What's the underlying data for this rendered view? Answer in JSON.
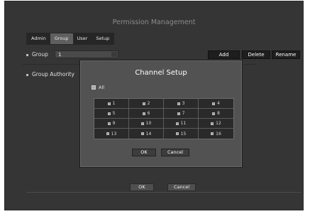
{
  "window": {
    "title": "Permission Management"
  },
  "tabs": [
    {
      "label": "Admin"
    },
    {
      "label": "Group"
    },
    {
      "label": "User"
    },
    {
      "label": "Setup"
    }
  ],
  "group_row": {
    "label": "Group",
    "value": "1"
  },
  "group_buttons": {
    "add": "Add",
    "delete": "Delete",
    "rename": "Rename"
  },
  "authority_row": {
    "label": "Group Authority"
  },
  "footer": {
    "ok": "OK",
    "cancel": "Cancel"
  },
  "modal": {
    "title": "Channel Setup",
    "all_label": "All",
    "channels": [
      "1",
      "2",
      "3",
      "4",
      "5",
      "6",
      "7",
      "8",
      "9",
      "10",
      "11",
      "12",
      "13",
      "14",
      "15",
      "16"
    ],
    "ok": "OK",
    "cancel": "Cancel"
  }
}
